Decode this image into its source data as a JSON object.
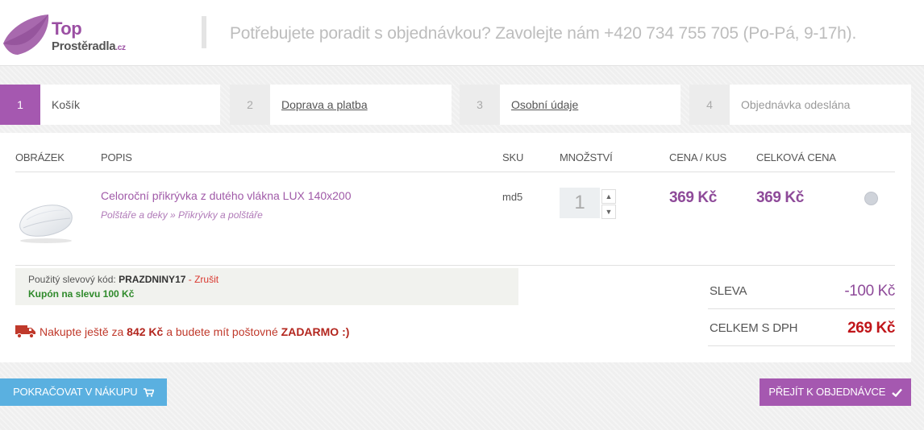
{
  "header": {
    "logo_top": "Top",
    "logo_sub": "Prostěradla",
    "logo_tld": ".cz",
    "phone_text": "Potřebujete poradit s objednávkou? Zavolejte nám +420 734 755 705 (Po-Pá, 9-17h)."
  },
  "steps": [
    {
      "num": "1",
      "label": "Košík"
    },
    {
      "num": "2",
      "label": "Doprava a platba"
    },
    {
      "num": "3",
      "label": "Osobní údaje"
    },
    {
      "num": "4",
      "label": "Objednávka odeslána"
    }
  ],
  "table": {
    "headers": [
      "OBRÁZEK",
      "POPIS",
      "SKU",
      "MNOŽSTVÍ",
      "CENA / KUS",
      "CELKOVÁ CENA"
    ]
  },
  "item": {
    "name": "Celoroční přikrývka z dutého vlákna LUX 140x200",
    "category": "Polštáře a deky » Přikrývky a polštáře",
    "sku": "md5",
    "quantity": "1",
    "unit_price": "369 Kč",
    "total_price": "369 Kč",
    "image_icon": "duvet-image"
  },
  "coupon": {
    "prefix": "Použitý slevový kód:",
    "code": "PRAZDNINY17",
    "separator": " - ",
    "cancel": "Zrušit",
    "message": "Kupón na slevu 100 Kč"
  },
  "shipping": {
    "icon": "truck-icon",
    "before": "Nakupte ještě za ",
    "amount": "842 Kč",
    "middle": " a budete mít poštovné ",
    "free": "ZADARMO :)"
  },
  "summary": {
    "discount_label": "SLEVA",
    "discount_value": "-100 Kč",
    "total_label": "CELKEM S DPH",
    "total_value": "269 Kč"
  },
  "buttons": {
    "continue": "POKRAČOVAT V NÁKUPU",
    "checkout": "PŘEJÍT K OBJEDNÁVCE"
  },
  "colors": {
    "accent": "#a558b0",
    "price": "#8e4a99",
    "total": "#c0161a",
    "continue_button": "#5ab0e0",
    "coupon_ok": "#2f8a2b"
  }
}
